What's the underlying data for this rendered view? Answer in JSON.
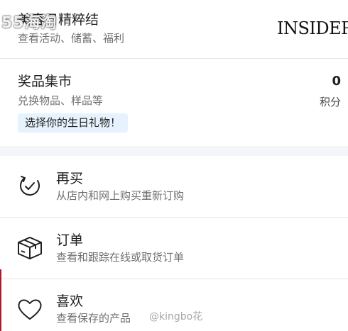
{
  "header": {
    "title": "美容日精粹结",
    "subtitle": "查看活动、储蓄、福利",
    "brand": "INSIDER",
    "watermark": "55海淘"
  },
  "rewards": {
    "title": "奖品集市",
    "subtitle": "兑换物品、样品等",
    "points_value": "0",
    "points_label": "积分",
    "birthday_pill": "选择你的生日礼物！"
  },
  "menu": {
    "reorder": {
      "title": "再买",
      "subtitle": "从店内和网上购买重新订购",
      "icon": "reorder-icon"
    },
    "orders": {
      "title": "订单",
      "subtitle": "查看和跟踪在线或取货订单",
      "icon": "package-icon"
    },
    "favorites": {
      "title": "喜欢",
      "subtitle": "查看保存的产品",
      "icon": "heart-icon"
    }
  },
  "footer": {
    "watermark": "@kingbo花"
  },
  "colors": {
    "pill_bg": "#e6f2fd",
    "band": "#f4f5f8",
    "accent_edge": "#b5172a"
  }
}
